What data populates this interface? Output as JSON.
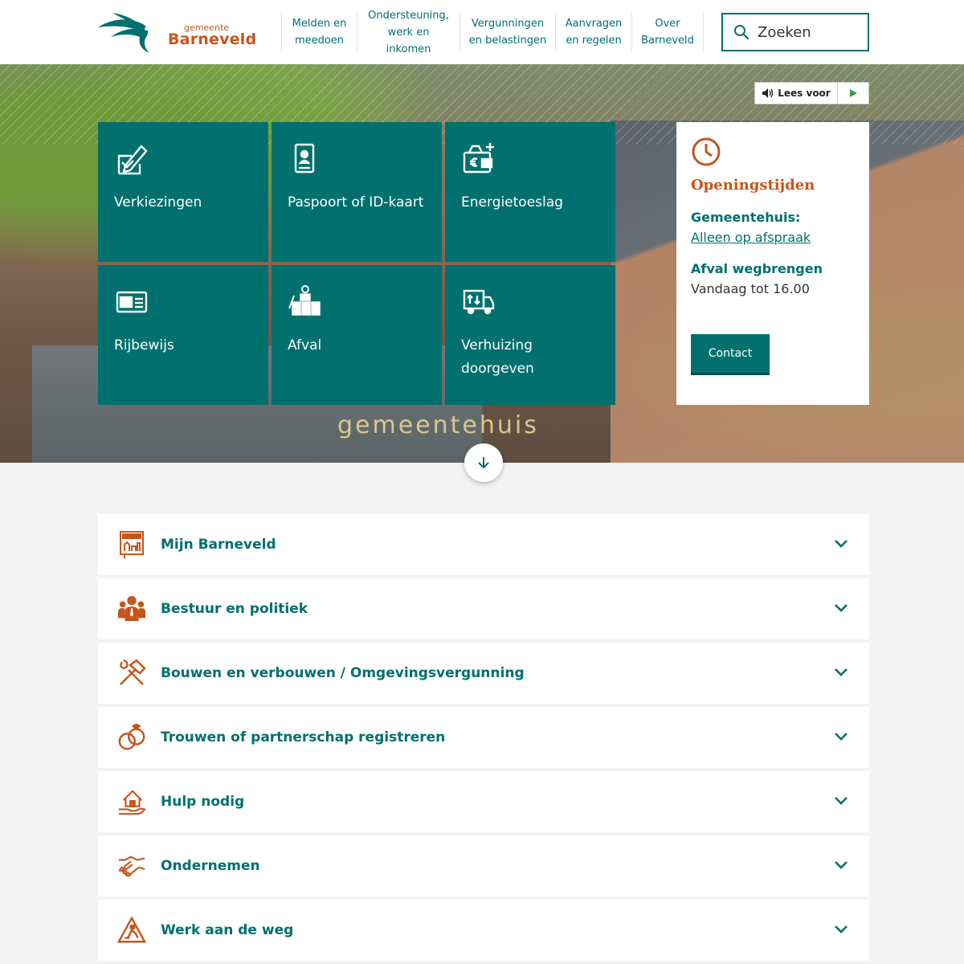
{
  "header": {
    "logo_small": "gemeente",
    "logo_big": "Barneveld",
    "nav": [
      {
        "line1": "Melden en",
        "line2": "meedoen"
      },
      {
        "line1": "Ondersteuning,",
        "line2": "werk en inkomen"
      },
      {
        "line1": "Vergunningen",
        "line2": "en belastingen"
      },
      {
        "line1": "Aanvragen",
        "line2": "en regelen"
      },
      {
        "line1": "Over",
        "line2": "Barneveld"
      }
    ],
    "search_placeholder": "Zoeken"
  },
  "hero": {
    "leesvoor_label": "Lees voor",
    "building_text": "gemeentehuis"
  },
  "tiles": [
    {
      "label": "Verkiezingen",
      "icon": "pencil-ballot-icon"
    },
    {
      "label": "Paspoort of ID-kaart",
      "icon": "passport-icon"
    },
    {
      "label": "Energietoeslag",
      "icon": "euro-wallet-icon"
    },
    {
      "label": "Rijbewijs",
      "icon": "driving-license-icon"
    },
    {
      "label": "Afval",
      "icon": "waste-bins-icon"
    },
    {
      "label": "Verhuizing doorgeven",
      "icon": "moving-truck-icon"
    }
  ],
  "hours": {
    "title": "Openingstijden",
    "town_hall_heading": "Gemeentehuis:",
    "town_hall_link": "Alleen op afspraak",
    "waste_heading": "Afval wegbrengen",
    "waste_text": "Vandaag tot 16.00",
    "contact_label": "Contact"
  },
  "accordion": [
    {
      "label": "Mijn Barneveld",
      "icon": "welcome-sign-icon"
    },
    {
      "label": "Bestuur en politiek",
      "icon": "people-group-icon"
    },
    {
      "label": "Bouwen en verbouwen / Omgevingsvergunning",
      "icon": "hammer-wrench-icon"
    },
    {
      "label": "Trouwen of partnerschap registreren",
      "icon": "rings-icon"
    },
    {
      "label": "Hulp nodig",
      "icon": "house-hand-icon"
    },
    {
      "label": "Ondernemen",
      "icon": "handshake-icon"
    },
    {
      "label": "Werk aan de weg",
      "icon": "road-works-icon"
    }
  ],
  "colors": {
    "primary": "#00706e",
    "accent": "#c7551b"
  }
}
